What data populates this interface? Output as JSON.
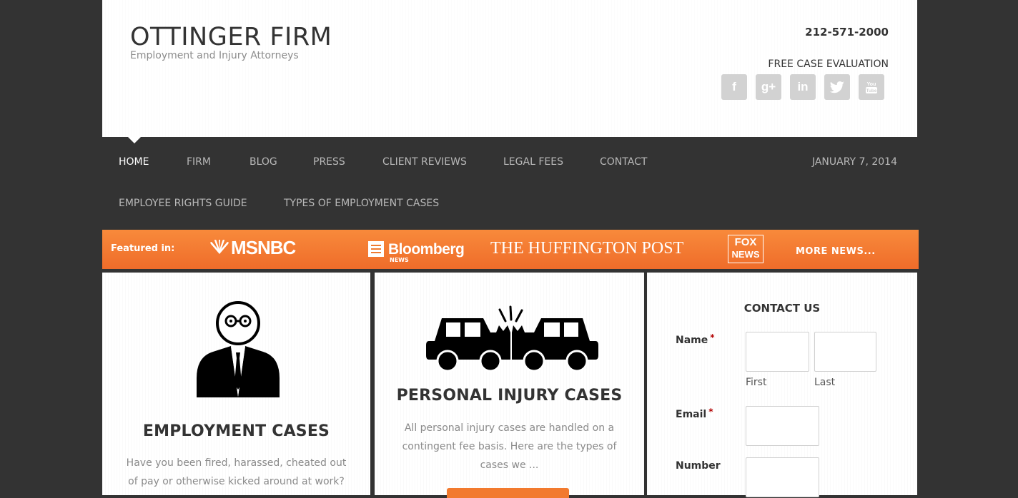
{
  "header": {
    "site_title": "OTTINGER FIRM",
    "tagline": "Employment and Injury Attorneys",
    "phone": "212-571-2000",
    "free_evaluation": "FREE CASE EVALUATION",
    "social": [
      {
        "icon": "facebook-icon",
        "glyph": "f"
      },
      {
        "icon": "google-plus-icon",
        "glyph": "g+"
      },
      {
        "icon": "linkedin-icon",
        "glyph": "in"
      },
      {
        "icon": "twitter-icon",
        "glyph": "🐦"
      },
      {
        "icon": "youtube-icon",
        "glyph": "▶"
      }
    ]
  },
  "nav": {
    "items": [
      {
        "label": "HOME",
        "active": true
      },
      {
        "label": "FIRM"
      },
      {
        "label": "BLOG"
      },
      {
        "label": "PRESS"
      },
      {
        "label": "CLIENT REVIEWS"
      },
      {
        "label": "LEGAL FEES"
      },
      {
        "label": "CONTACT"
      },
      {
        "label": "EMPLOYEE RIGHTS GUIDE"
      },
      {
        "label": "TYPES OF EMPLOYMENT CASES"
      }
    ],
    "date": "JANUARY 7, 2014"
  },
  "featured": {
    "label": "Featured in:",
    "msnbc": "MSNBC",
    "bloomberg": "Bloomberg",
    "bloomberg_sub": "NEWS",
    "huffington": "THE HUFFINGTON POST",
    "fox_top": "FOX",
    "fox_bottom": "NEWS",
    "more": "MORE NEWS..."
  },
  "employment": {
    "title": "EMPLOYMENT CASES",
    "text": "Have you been fired, harassed, cheated out of pay or otherwise kicked around at work?"
  },
  "injury": {
    "title": "PERSONAL INJURY CASES",
    "text": "All personal injury cases are handled on a contingent fee basis.  Here are the types of cases we ..."
  },
  "contact": {
    "title": "CONTACT US",
    "name_label": "Name",
    "required_mark": "*",
    "first_label": "First",
    "last_label": "Last",
    "email_label": "Email",
    "number_label": "Number",
    "first_value": "",
    "last_value": "",
    "email_value": "",
    "number_value": ""
  },
  "colors": {
    "background": "#333333",
    "accent": "#f27a2e",
    "required": "#b20000"
  }
}
